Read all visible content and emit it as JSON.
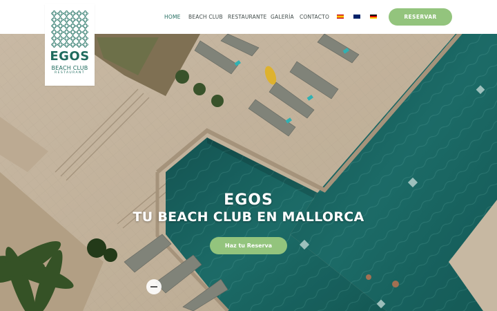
{
  "logo": {
    "title": "EGOS",
    "subtitle": "BEACH CLUB",
    "tagline": "RESTAURANT"
  },
  "nav": {
    "items": [
      {
        "label": "HOME",
        "active": true
      },
      {
        "label": "BEACH CLUB",
        "active": false
      },
      {
        "label": "RESTAURANTE",
        "active": false
      },
      {
        "label": "GALERÍA",
        "active": false
      },
      {
        "label": "CONTACTO",
        "active": false
      }
    ],
    "languages": [
      "es-flag-icon",
      "en-flag-icon",
      "de-flag-icon"
    ],
    "reserve_label": "RESERVAR"
  },
  "hero": {
    "title": "EGOS",
    "subtitle": "TU BEACH CLUB EN MALLORCA",
    "cta_label": "Haz tu Reserva"
  },
  "colors": {
    "brand_green": "#1f6b5e",
    "button_green": "#93c47d",
    "pool_teal": "#1d6b66",
    "deck_sand": "#d4c3ac"
  }
}
